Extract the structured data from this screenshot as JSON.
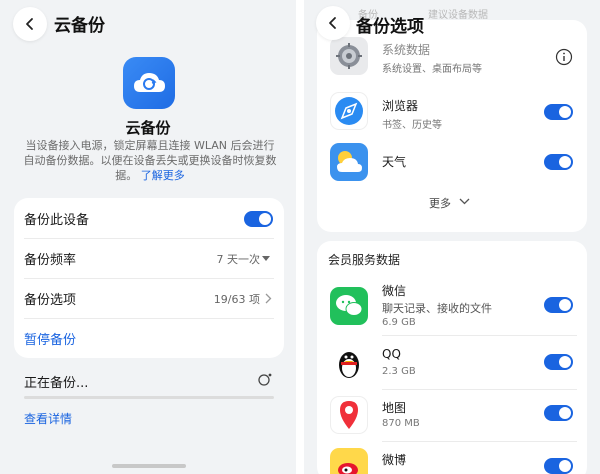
{
  "left": {
    "title": "云备份",
    "app_name": "云备份",
    "description": "当设备接入电源，锁定屏幕且连接 WLAN 后会进行自动备份数据。以便在设备丢失或更换设备时恢复数据。",
    "learn_more": "了解更多",
    "settings": {
      "backup_device_label": "备份此设备",
      "backup_device_enabled": true,
      "frequency_label": "备份频率",
      "frequency_value": "7 天一次",
      "options_label": "备份选项",
      "options_value": "19/63 项",
      "pause_label": "暂停备份"
    },
    "status": {
      "label": "正在备份...",
      "details_link": "查看详情",
      "icon": "spinner-icon"
    }
  },
  "right": {
    "title": "备份选项",
    "faded_header_left": "备份",
    "faded_header_right": "建议设备数据",
    "top_items": [
      {
        "name": "系统数据",
        "sub": "系统设置、桌面布局等",
        "icon": "settings-gear-icon",
        "control": "info"
      },
      {
        "name": "浏览器",
        "sub": "书签、历史等",
        "icon": "browser-compass-icon",
        "control": "toggle",
        "on": true
      },
      {
        "name": "天气",
        "sub": "",
        "icon": "weather-sun-cloud-icon",
        "control": "toggle",
        "on": true
      }
    ],
    "more_label": "更多",
    "section_title": "会员服务数据",
    "member_items": [
      {
        "name": "微信",
        "sub": "聊天记录、接收的文件",
        "size": "6.9 GB",
        "icon": "wechat-icon",
        "on": true
      },
      {
        "name": "QQ",
        "sub": "",
        "size": "2.3 GB",
        "icon": "qq-penguin-icon",
        "on": true
      },
      {
        "name": "地图",
        "sub": "",
        "size": "870 MB",
        "icon": "map-pin-icon",
        "on": true
      },
      {
        "name": "微博",
        "sub": "",
        "size": "",
        "icon": "weibo-icon",
        "on": true
      }
    ]
  },
  "colors": {
    "accent": "#1a64e0",
    "background": "#f1f3f5",
    "card": "#ffffff"
  }
}
